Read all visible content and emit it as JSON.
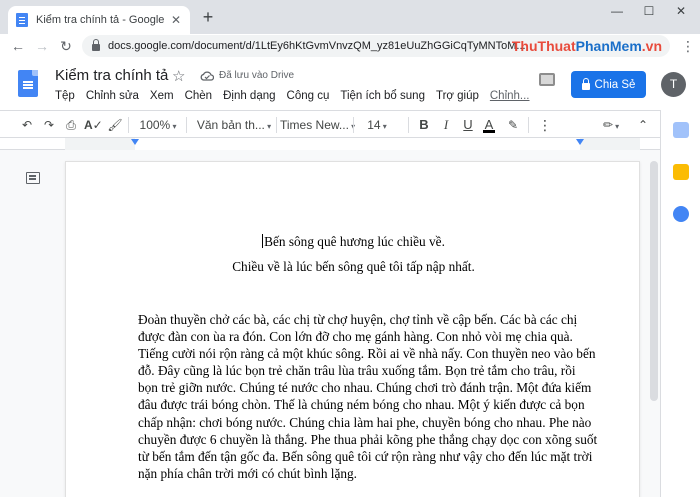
{
  "browser": {
    "tab_title": "Kiểm tra chính tả - Google Tài liệu",
    "tab_close": "✕",
    "new_tab": "+",
    "url": "docs.google.com/document/d/1LtEy6hKtGvmVnvzQM_yz81eUuZhGGiCqTyMNToM...",
    "watermark_a": "ThuThuat",
    "watermark_b": "PhanMem",
    "watermark_c": ".vn",
    "window_controls": [
      "—",
      "☐",
      "✕"
    ]
  },
  "docs": {
    "title": "Kiểm tra chính tả",
    "saved_status": "Đã lưu vào Drive",
    "menu": [
      "Tệp",
      "Chỉnh sửa",
      "Xem",
      "Chèn",
      "Định dạng",
      "Công cụ",
      "Tiện ích bổ sung",
      "Trợ giúp",
      "Chỉnh..."
    ],
    "share_label": "Chia Sẻ",
    "avatar_initial": "T"
  },
  "toolbar": {
    "zoom": "100%",
    "style": "Văn bản th...",
    "font": "Times New...",
    "font_size": "14",
    "bold": "B",
    "italic": "I",
    "underline": "U",
    "text_color": "A"
  },
  "document": {
    "heading1": "Bến sông quê hương lúc chiều về.",
    "heading2": "Chiều về là lúc bến sông quê tôi tấp nập nhất.",
    "paragraph": "Đoàn thuyền chở các bà, các chị từ chợ huyện, chợ tỉnh về cập bến. Các bà các chị được đàn con ùa ra đón. Con lớn đỡ cho mẹ gánh hàng. Con nhỏ vòi mẹ chia quà. Tiếng cười nói rộn ràng cả một khúc sông. Rồi ai về nhà nấy. Con thuyền neo vào bến đỗ. Đây cũng là lúc bọn trẻ chăn trâu lùa trâu xuống tắm. Bọn trẻ tắm cho trâu, rồi bọn trẻ giỡn nước. Chúng té nước cho nhau. Chúng chơi trò đánh trận. Một đứa kiếm đâu được trái bóng chòn. Thế là chúng ném bóng cho nhau. Một ý kiến được cả bọn chấp nhận: chơi bóng nước. Chúng chia làm hai phe, chuyền bóng cho nhau. Phe nào chuyền được 6 chuyền là thắng. Phe thua phải kõng phe thắng chạy dọc con xõng suốt từ bến tắm đến tận gốc đa. Bến sông quê tôi cứ rộn ràng như vậy cho đến lúc mặt trời nặn phía chân trời mới có chút bình lặng."
  }
}
